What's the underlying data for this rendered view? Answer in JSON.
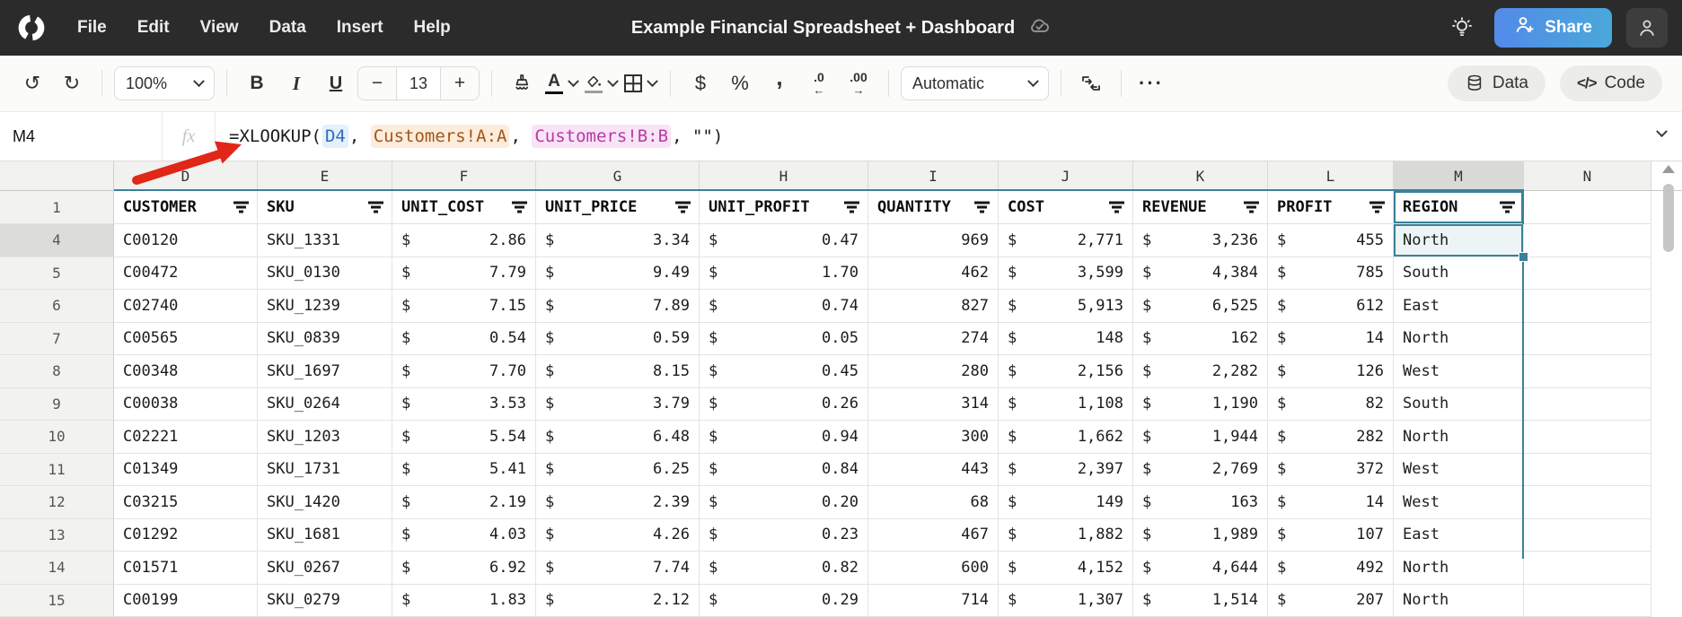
{
  "topbar": {
    "menu": [
      "File",
      "Edit",
      "View",
      "Data",
      "Insert",
      "Help"
    ],
    "title": "Example Financial Spreadsheet + Dashboard",
    "share": "Share"
  },
  "toolbar": {
    "undo": "↺",
    "redo": "↻",
    "zoom_value": "100%",
    "bold": "B",
    "italic": "I",
    "underline": "U",
    "size_minus": "−",
    "size_value": "13",
    "size_plus": "+",
    "text_color_letter": "A",
    "currency": "$",
    "percent": "%",
    "comma": ",",
    "dec_decrease": ".0",
    "dec_decrease_arrow": "←",
    "dec_increase": ".00",
    "dec_increase_arrow": "→",
    "number_format": "Automatic",
    "more": "···",
    "data_label": "Data",
    "code_glyph": "</>",
    "code_label": "Code"
  },
  "formula_bar": {
    "cell_ref": "M4",
    "fx_label": "fx",
    "formula_full": "=XLOOKUP(D4, Customers!A:A, Customers!B:B, \"\")",
    "parts": [
      {
        "text": "=XLOOKUP(",
        "style": "plain"
      },
      {
        "text": "D4",
        "style": "blue"
      },
      {
        "text": ", ",
        "style": "plain"
      },
      {
        "text": "Customers!A:A",
        "style": "orange"
      },
      {
        "text": ", ",
        "style": "plain"
      },
      {
        "text": "Customers!B:B",
        "style": "magenta"
      },
      {
        "text": ", \"\")",
        "style": "plain"
      }
    ]
  },
  "sheet": {
    "column_letters": [
      "D",
      "E",
      "F",
      "G",
      "H",
      "I",
      "J",
      "K",
      "L",
      "M",
      "N"
    ],
    "selected_column_letter": "M",
    "selected_row_number": "4",
    "selected_cell_ref": "M4",
    "header_row_number": "1",
    "headers": [
      "CUSTOMER",
      "SKU",
      "UNIT_COST",
      "UNIT_PRICE",
      "UNIT_PROFIT",
      "QUANTITY",
      "COST",
      "REVENUE",
      "PROFIT",
      "REGION"
    ],
    "column_types": [
      "text",
      "text",
      "currency",
      "currency",
      "currency",
      "number",
      "currency",
      "currency",
      "currency",
      "text"
    ],
    "currency_symbol": "$",
    "rows": [
      {
        "n": "4",
        "cells": [
          "C00120",
          "SKU_1331",
          "2.86",
          "3.34",
          "0.47",
          "969",
          "2,771",
          "3,236",
          "455",
          "North"
        ]
      },
      {
        "n": "5",
        "cells": [
          "C00472",
          "SKU_0130",
          "7.79",
          "9.49",
          "1.70",
          "462",
          "3,599",
          "4,384",
          "785",
          "South"
        ]
      },
      {
        "n": "6",
        "cells": [
          "C02740",
          "SKU_1239",
          "7.15",
          "7.89",
          "0.74",
          "827",
          "5,913",
          "6,525",
          "612",
          "East"
        ]
      },
      {
        "n": "7",
        "cells": [
          "C00565",
          "SKU_0839",
          "0.54",
          "0.59",
          "0.05",
          "274",
          "148",
          "162",
          "14",
          "North"
        ]
      },
      {
        "n": "8",
        "cells": [
          "C00348",
          "SKU_1697",
          "7.70",
          "8.15",
          "0.45",
          "280",
          "2,156",
          "2,282",
          "126",
          "West"
        ]
      },
      {
        "n": "9",
        "cells": [
          "C00038",
          "SKU_0264",
          "3.53",
          "3.79",
          "0.26",
          "314",
          "1,108",
          "1,190",
          "82",
          "South"
        ]
      },
      {
        "n": "10",
        "cells": [
          "C02221",
          "SKU_1203",
          "5.54",
          "6.48",
          "0.94",
          "300",
          "1,662",
          "1,944",
          "282",
          "North"
        ]
      },
      {
        "n": "11",
        "cells": [
          "C01349",
          "SKU_1731",
          "5.41",
          "6.25",
          "0.84",
          "443",
          "2,397",
          "2,769",
          "372",
          "West"
        ]
      },
      {
        "n": "12",
        "cells": [
          "C03215",
          "SKU_1420",
          "2.19",
          "2.39",
          "0.20",
          "68",
          "149",
          "163",
          "14",
          "West"
        ]
      },
      {
        "n": "13",
        "cells": [
          "C01292",
          "SKU_1681",
          "4.03",
          "4.26",
          "0.23",
          "467",
          "1,882",
          "1,989",
          "107",
          "East"
        ]
      },
      {
        "n": "14",
        "cells": [
          "C01571",
          "SKU_0267",
          "6.92",
          "7.74",
          "0.82",
          "600",
          "4,152",
          "4,644",
          "492",
          "North"
        ]
      },
      {
        "n": "15",
        "cells": [
          "C00199",
          "SKU_0279",
          "1.83",
          "2.12",
          "0.29",
          "714",
          "1,307",
          "1,514",
          "207",
          "North"
        ]
      }
    ]
  },
  "colors": {
    "topbar_bg": "#2b2b2b",
    "accent_teal": "#3a8199",
    "selection_fill": "#ecf4f6",
    "share_gradient_start": "#528ae9",
    "share_gradient_end": "#4aa8da",
    "annotation_red": "#e02718",
    "ref_blue": "#3569c7",
    "ref_orange": "#a2561b",
    "ref_magenta": "#b73aa5"
  }
}
